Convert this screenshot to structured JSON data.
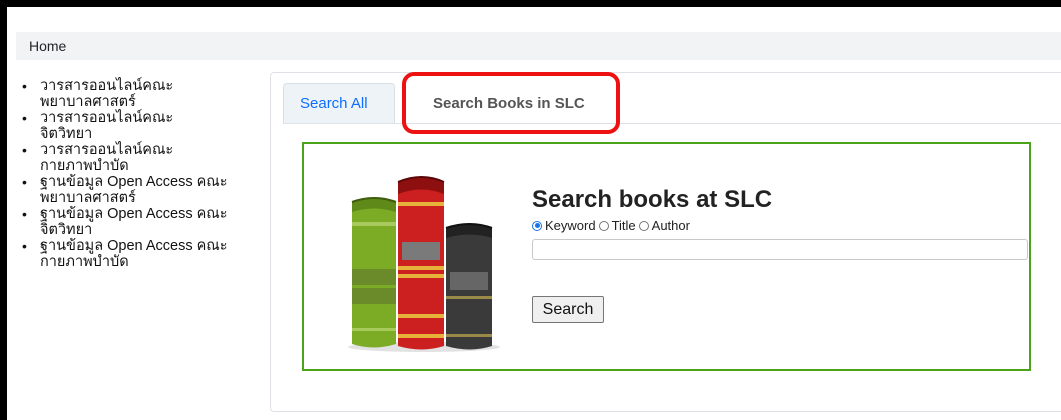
{
  "breadcrumb": {
    "home": "Home"
  },
  "sidebar": {
    "items": [
      {
        "label": "วารสารออนไลน์คณะพยาบาลศาสตร์"
      },
      {
        "label": "วารสารออนไลน์คณะจิตวิทยา"
      },
      {
        "label": "วารสารออนไลน์คณะกายภาพบำบัด"
      },
      {
        "label": "ฐานข้อมูล Open Access คณะพยาบาลศาสตร์"
      },
      {
        "label": "ฐานข้อมูล Open Access คณะจิตวิทยา"
      },
      {
        "label": "ฐานข้อมูล Open Access คณะกายภาพบำบัด"
      }
    ]
  },
  "tabs": [
    {
      "label": "Search All",
      "active": false
    },
    {
      "label": "Search Books in SLC",
      "active": true
    }
  ],
  "search": {
    "title": "Search books at SLC",
    "options": [
      {
        "label": "Keyword",
        "checked": true
      },
      {
        "label": "Title",
        "checked": false
      },
      {
        "label": "Author",
        "checked": false
      }
    ],
    "input_value": "",
    "button_label": "Search"
  },
  "colors": {
    "link_blue": "#0d6efd",
    "highlight_red": "#ee1111",
    "box_green": "#4aa319",
    "breadcrumb_bg": "#f1f3f4"
  },
  "icons": {
    "books_illustration": "books-icon"
  }
}
